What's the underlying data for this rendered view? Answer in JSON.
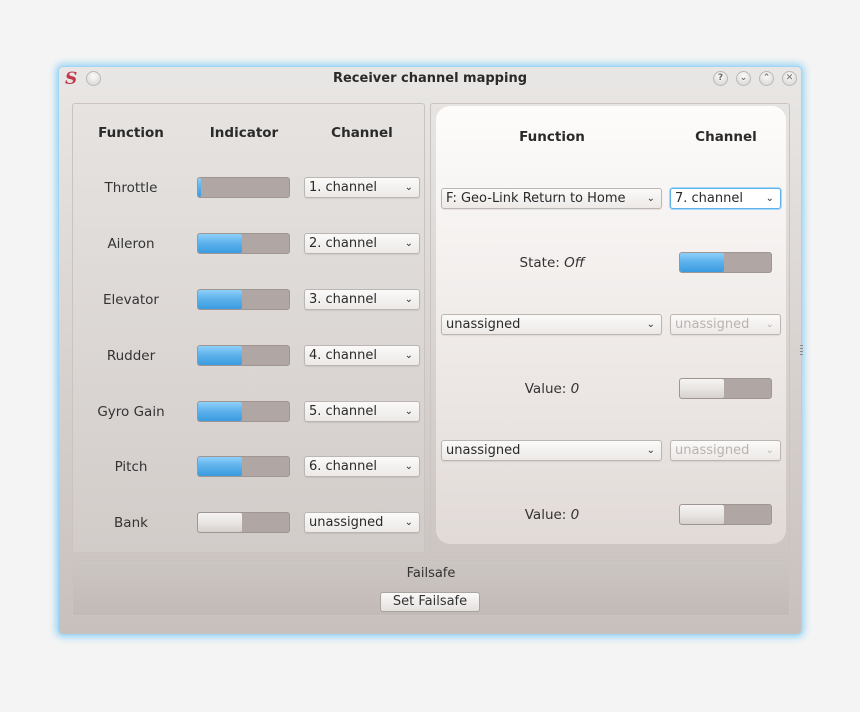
{
  "window": {
    "title": "Receiver channel mapping",
    "app_icon": "S",
    "buttons": {
      "help": "?",
      "minimize": "⌄",
      "maximize": "⌃",
      "close": "✕"
    }
  },
  "left_panel": {
    "headers": {
      "function": "Function",
      "indicator": "Indicator",
      "channel": "Channel"
    },
    "rows": [
      {
        "function": "Throttle",
        "indicator_fill": 0.02,
        "indicator_active": true,
        "channel": "1. channel"
      },
      {
        "function": "Aileron",
        "indicator_fill": 0.48,
        "indicator_active": true,
        "channel": "2. channel"
      },
      {
        "function": "Elevator",
        "indicator_fill": 0.48,
        "indicator_active": true,
        "channel": "3. channel"
      },
      {
        "function": "Rudder",
        "indicator_fill": 0.48,
        "indicator_active": true,
        "channel": "4. channel"
      },
      {
        "function": "Gyro Gain",
        "indicator_fill": 0.48,
        "indicator_active": true,
        "channel": "5. channel"
      },
      {
        "function": "Pitch",
        "indicator_fill": 0.48,
        "indicator_active": true,
        "channel": "6. channel"
      },
      {
        "function": "Bank",
        "indicator_fill": 0.48,
        "indicator_active": false,
        "channel": "unassigned"
      }
    ]
  },
  "right_panel": {
    "headers": {
      "function": "Function",
      "channel": "Channel"
    },
    "entries": [
      {
        "function": "F: Geo-Link Return to Home",
        "channel": "7. channel",
        "channel_focused": true,
        "channel_disabled": false,
        "status_label": "State:",
        "status_value": "Off",
        "indicator_fill": 0.48,
        "indicator_active": true
      },
      {
        "function": "unassigned",
        "channel": "unassigned",
        "channel_focused": false,
        "channel_disabled": true,
        "status_label": "Value:",
        "status_value": "0",
        "indicator_fill": 0.48,
        "indicator_active": false
      },
      {
        "function": "unassigned",
        "channel": "unassigned",
        "channel_focused": false,
        "channel_disabled": true,
        "status_label": "Value:",
        "status_value": "0",
        "indicator_fill": 0.48,
        "indicator_active": false
      }
    ]
  },
  "failsafe": {
    "title": "Failsafe",
    "button_label": "Set Failsafe"
  },
  "colors": {
    "accent": "#5fb3ec",
    "window_glow": "#8fd0f3",
    "logo": "#c0384a"
  }
}
